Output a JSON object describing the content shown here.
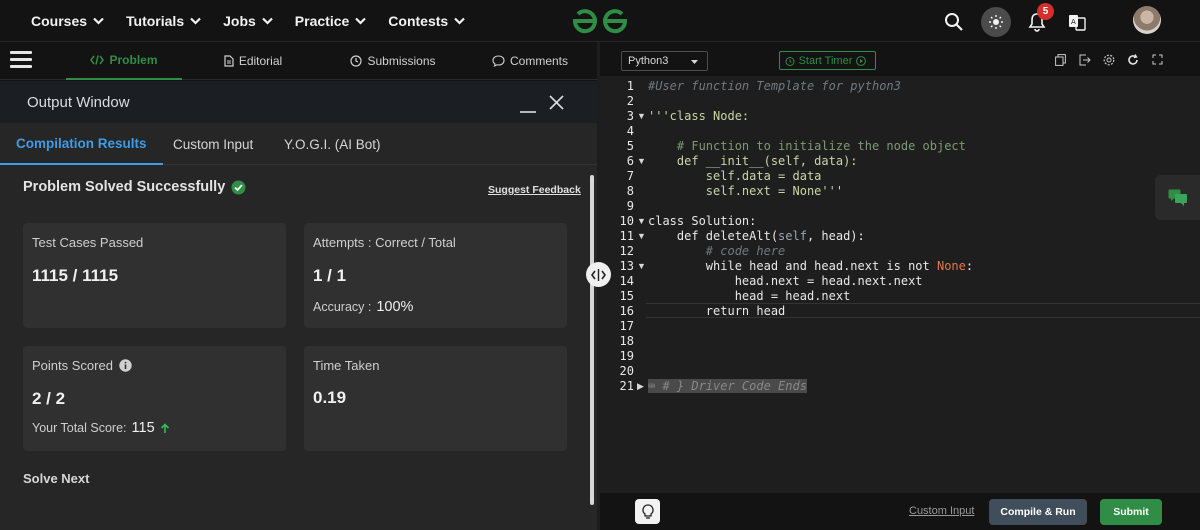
{
  "nav": {
    "menu": [
      {
        "label": "Courses"
      },
      {
        "label": "Tutorials"
      },
      {
        "label": "Jobs"
      },
      {
        "label": "Practice"
      },
      {
        "label": "Contests"
      }
    ],
    "notifications_count": "5",
    "logo_icon": "geeksforgeeks-logo",
    "icons": [
      "search-icon",
      "theme-toggle-icon",
      "bell-icon",
      "translate-icon",
      "avatar"
    ]
  },
  "problem_tabs": [
    {
      "label": "Problem",
      "icon": "code-icon",
      "active": true
    },
    {
      "label": "Editorial",
      "icon": "document-icon"
    },
    {
      "label": "Submissions",
      "icon": "clock-icon"
    },
    {
      "label": "Comments",
      "icon": "comment-icon"
    }
  ],
  "output": {
    "title": "Output Window",
    "tabs": [
      {
        "label": "Compilation Results",
        "active": true
      },
      {
        "label": "Custom Input"
      },
      {
        "label": "Y.O.G.I. (AI Bot)"
      }
    ],
    "status": "Problem Solved Successfully",
    "suggest_feedback": "Suggest Feedback",
    "cards": {
      "test_cases": {
        "label": "Test Cases Passed",
        "value": "1115 / 1115"
      },
      "attempts": {
        "label": "Attempts : Correct / Total",
        "value": "1 / 1",
        "accuracy_label": "Accuracy :",
        "accuracy_value": "100%"
      },
      "points": {
        "label": "Points Scored",
        "value": "2 / 2",
        "total_label": "Your Total Score:",
        "total_value": "115"
      },
      "time": {
        "label": "Time Taken",
        "value": "0.19"
      }
    },
    "solve_next": "Solve Next"
  },
  "editor": {
    "language": "Python3",
    "start_timer": "Start Timer",
    "line_numbers": [
      "1",
      "2",
      "3",
      "4",
      "5",
      "6",
      "7",
      "8",
      "9",
      "10",
      "11",
      "12",
      "13",
      "14",
      "15",
      "16",
      "17",
      "18",
      "19",
      "20",
      "21"
    ],
    "code": {
      "l1": "#User function Template for python3",
      "l3": "'''class Node:",
      "l5": "    # Function to initialize the node object",
      "l6_def": "    def ",
      "l6_rest": "__init__(self, data):",
      "l7": "        self.data = data",
      "l8": "        self.next = None'''",
      "l10": "class Solution:",
      "l11_def": "    def ",
      "l11_name": "deleteAlt(",
      "l11_self": "self",
      "l11_rest": ", head):",
      "l12": "        # code here",
      "l13_a": "        while head and head.next is not ",
      "l13_none": "None",
      "l13_b": ":",
      "l14": "            head.next = head.next.next",
      "l15": "            head = head.next",
      "l16": "        return head",
      "l21": "# } Driver Code Ends"
    }
  },
  "footer": {
    "custom_input": "Custom Input",
    "compile_run": "Compile & Run",
    "submit": "Submit"
  },
  "colors": {
    "accent_green": "#2f8d46",
    "tab_blue": "#3f9be6",
    "badge_red": "#d32f2f"
  }
}
